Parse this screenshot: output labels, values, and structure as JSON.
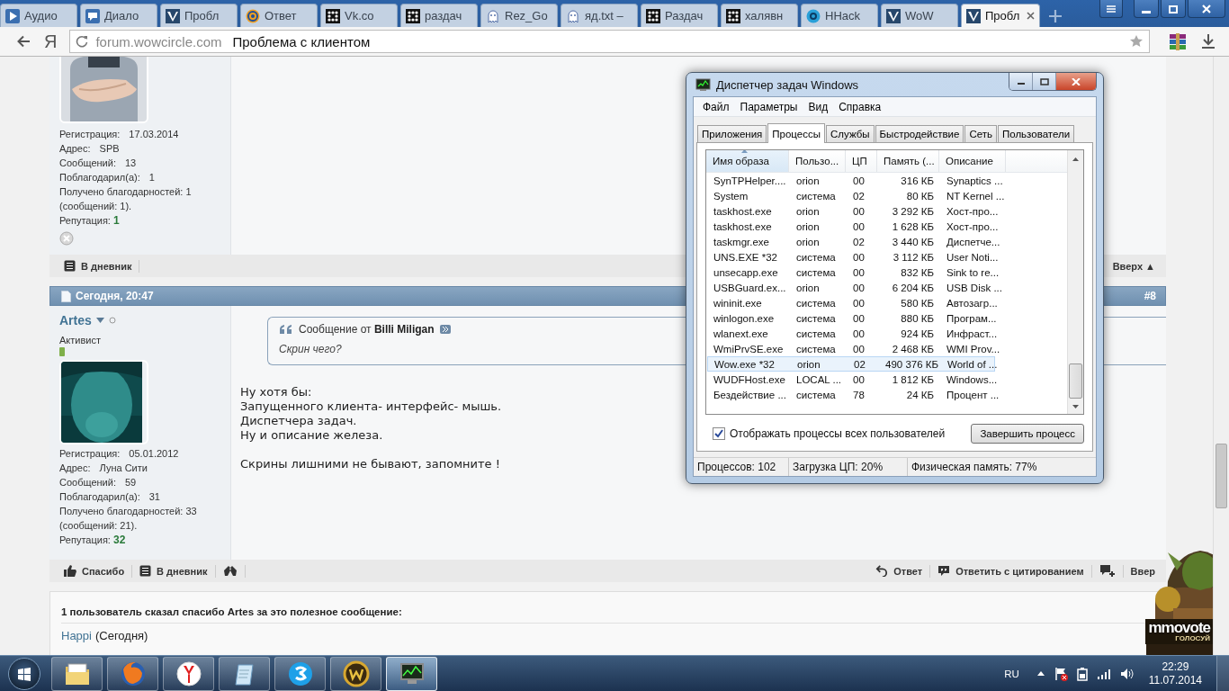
{
  "browser": {
    "tabs": [
      {
        "label": "Аудио",
        "selected": false
      },
      {
        "label": "Диало",
        "selected": false
      },
      {
        "label": "Пробл",
        "selected": false
      },
      {
        "label": "Ответ",
        "selected": false
      },
      {
        "label": "Vk.co",
        "selected": false
      },
      {
        "label": "раздач",
        "selected": false
      },
      {
        "label": "Rez_Go",
        "selected": false
      },
      {
        "label": "яд.txt –",
        "selected": false
      },
      {
        "label": "Раздач",
        "selected": false
      },
      {
        "label": "халявн",
        "selected": false
      },
      {
        "label": "HHack",
        "selected": false
      },
      {
        "label": "WoW",
        "selected": false
      },
      {
        "label": "Пробл",
        "selected": true
      }
    ],
    "home_button": "Я",
    "address": {
      "domain": "forum.wowcircle.com",
      "title": "Проблема с клиентом"
    }
  },
  "posts": [
    {
      "stats": [
        {
          "label": "Регистрация:",
          "value": "17.03.2014"
        },
        {
          "label": "Адрес:",
          "value": "SPB"
        },
        {
          "label": "Сообщений:",
          "value": "13"
        },
        {
          "label": "Поблагодарил(а):",
          "value": "1"
        }
      ],
      "thanks_received": [
        "Получено благодарностей: 1",
        "(сообщений: 1)."
      ],
      "reputation": {
        "label": "Репутация:",
        "value": "1"
      },
      "skype_icon": true,
      "actions_left": [
        {
          "kind": "diary",
          "label": "В дневник"
        }
      ],
      "actions_right": [
        {
          "kind": "top",
          "label": "Вверх ▲"
        }
      ]
    },
    {
      "header": {
        "date": "Сегодня, 20:47",
        "number": "#8"
      },
      "user": {
        "name": "Artes",
        "rank": "Активист"
      },
      "stats": [
        {
          "label": "Регистрация:",
          "value": "05.01.2012"
        },
        {
          "label": "Адрес:",
          "value": "Луна Сити"
        },
        {
          "label": "Сообщений:",
          "value": "59"
        },
        {
          "label": "Поблагодарил(а):",
          "value": "31"
        }
      ],
      "thanks_received": [
        "Получено благодарностей: 33",
        "(сообщений: 21)."
      ],
      "reputation": {
        "label": "Репутация:",
        "value": "32"
      },
      "quote": {
        "title": "Сообщение от **Billi Miligan**",
        "text": "Скрин чего?"
      },
      "paragraphs": [
        [
          "Ну хотя бы:",
          "Запущенного клиента- интерфейс- мышь.",
          "Диспетчера задач.",
          "Ну и описание железа."
        ],
        [
          "Скрины лишними не бывают, запомните !"
        ]
      ],
      "actions_left": [
        {
          "kind": "thanks",
          "label": "Спасибо"
        },
        {
          "kind": "diary",
          "label": "В дневник"
        },
        {
          "kind": "hands"
        }
      ],
      "actions_right": [
        {
          "kind": "reply",
          "label": "Ответ"
        },
        {
          "kind": "quote",
          "label": "Ответить с цитированием"
        },
        {
          "kind": "multiquote"
        },
        {
          "kind": "top",
          "label": "Ввер"
        }
      ]
    }
  ],
  "thanks": {
    "title": "1 пользователь сказал спасибо Artes за это полезное сообщение:",
    "users": [
      {
        "name": "Happi",
        "when": "(Сегодня)"
      }
    ]
  },
  "ad": {
    "brand": "mmovote",
    "caption": "ГОЛОСУЙ"
  },
  "task_manager": {
    "title": "Диспетчер задач Windows",
    "menu": [
      "Файл",
      "Параметры",
      "Вид",
      "Справка"
    ],
    "tabs": [
      {
        "label": "Приложения",
        "selected": false
      },
      {
        "label": "Процессы",
        "selected": true
      },
      {
        "label": "Службы",
        "selected": false
      },
      {
        "label": "Быстродействие",
        "selected": false
      },
      {
        "label": "Сеть",
        "selected": false
      },
      {
        "label": "Пользователи",
        "selected": false
      }
    ],
    "columns": [
      "Имя образа",
      "Пользо...",
      "ЦП",
      "Память (...",
      "Описание"
    ],
    "rows": [
      {
        "cells": [
          "SynTPHelper....",
          "orion",
          "00",
          "316 КБ",
          "Synaptics ..."
        ],
        "selected": false
      },
      {
        "cells": [
          "System",
          "система",
          "02",
          "80 КБ",
          "NT Kernel ..."
        ],
        "selected": false
      },
      {
        "cells": [
          "taskhost.exe",
          "orion",
          "00",
          "3 292 КБ",
          "Хост-про..."
        ],
        "selected": false
      },
      {
        "cells": [
          "taskhost.exe",
          "orion",
          "00",
          "1 628 КБ",
          "Хост-про..."
        ],
        "selected": false
      },
      {
        "cells": [
          "taskmgr.exe",
          "orion",
          "02",
          "3 440 КБ",
          "Диспетче..."
        ],
        "selected": false
      },
      {
        "cells": [
          "UNS.EXE *32",
          "система",
          "00",
          "3 112 КБ",
          "User Noti..."
        ],
        "selected": false
      },
      {
        "cells": [
          "unsecapp.exe",
          "система",
          "00",
          "832 КБ",
          "Sink to re..."
        ],
        "selected": false
      },
      {
        "cells": [
          "USBGuard.ex...",
          "orion",
          "00",
          "6 204 КБ",
          "USB Disk ..."
        ],
        "selected": false
      },
      {
        "cells": [
          "wininit.exe",
          "система",
          "00",
          "580 КБ",
          "Автозагр..."
        ],
        "selected": false
      },
      {
        "cells": [
          "winlogon.exe",
          "система",
          "00",
          "880 КБ",
          "Програм..."
        ],
        "selected": false
      },
      {
        "cells": [
          "wlanext.exe",
          "система",
          "00",
          "924 КБ",
          "Инфраст..."
        ],
        "selected": false
      },
      {
        "cells": [
          "WmiPrvSE.exe",
          "система",
          "00",
          "2 468 КБ",
          "WMI Prov..."
        ],
        "selected": false
      },
      {
        "cells": [
          "Wow.exe *32",
          "orion",
          "02",
          "490 376 КБ",
          "World of ..."
        ],
        "selected": true
      },
      {
        "cells": [
          "WUDFHost.exe",
          "LOCAL ...",
          "00",
          "1 812 КБ",
          "Windows..."
        ],
        "selected": false
      },
      {
        "cells": [
          "Бездействие ...",
          "система",
          "78",
          "24 КБ",
          "Процент ..."
        ],
        "selected": false
      }
    ],
    "show_all": {
      "label": "Отображать процессы всех пользователей",
      "checked": true
    },
    "end_button": "Завершить процесс",
    "status": [
      "Процессов: 102",
      "Загрузка ЦП: 20%",
      "Физическая память: 77%"
    ]
  },
  "taskbar": {
    "apps": [
      {
        "kind": "folder",
        "active": false
      },
      {
        "kind": "firefox",
        "active": false
      },
      {
        "kind": "yandex",
        "active": false
      },
      {
        "kind": "notepad",
        "active": false
      },
      {
        "kind": "call",
        "active": false
      },
      {
        "kind": "game",
        "active": false
      },
      {
        "kind": "monitor",
        "active": true
      }
    ],
    "language": "RU",
    "time": "22:29",
    "date": "11.07.2014"
  }
}
